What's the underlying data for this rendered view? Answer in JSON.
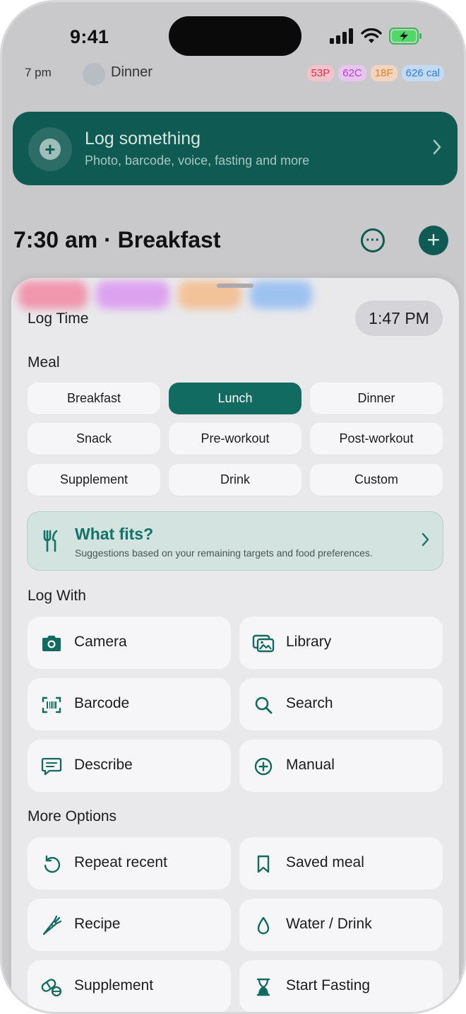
{
  "status_bar": {
    "time": "9:41"
  },
  "background": {
    "dinner_row": {
      "time": "7 pm",
      "label": "Dinner",
      "macros": [
        "53P",
        "62C",
        "18F",
        "626 cal"
      ]
    },
    "log_banner": {
      "title": "Log something",
      "subtitle": "Photo, barcode, voice, fasting and more"
    },
    "meal_title": "7:30 am · Breakfast"
  },
  "sheet": {
    "log_time_label": "Log Time",
    "log_time_value": "1:47 PM",
    "meal_label": "Meal",
    "meals": [
      "Breakfast",
      "Lunch",
      "Dinner",
      "Snack",
      "Pre-workout",
      "Post-workout",
      "Supplement",
      "Drink",
      "Custom"
    ],
    "selected_meal": "Lunch",
    "what_fits": {
      "title": "What fits?",
      "subtitle": "Suggestions based on your remaining targets and food preferences."
    },
    "log_with_label": "Log With",
    "log_with": [
      {
        "label": "Camera",
        "icon": "camera-icon"
      },
      {
        "label": "Library",
        "icon": "photo-library-icon"
      },
      {
        "label": "Barcode",
        "icon": "barcode-icon"
      },
      {
        "label": "Search",
        "icon": "search-icon"
      },
      {
        "label": "Describe",
        "icon": "chat-bubble-icon"
      },
      {
        "label": "Manual",
        "icon": "plus-circle-icon"
      }
    ],
    "more_options_label": "More Options",
    "more_options": [
      {
        "label": "Repeat recent",
        "icon": "repeat-icon"
      },
      {
        "label": "Saved meal",
        "icon": "bookmark-icon"
      },
      {
        "label": "Recipe",
        "icon": "carrot-icon"
      },
      {
        "label": "Water / Drink",
        "icon": "water-drop-icon"
      },
      {
        "label": "Supplement",
        "icon": "pill-icon"
      },
      {
        "label": "Start Fasting",
        "icon": "hourglass-icon"
      }
    ]
  },
  "colors": {
    "accent": "#126b61",
    "banner": "#0f5a52",
    "sheet_bg": "#e9e9ec",
    "button_bg": "#f6f6f8",
    "protein": "#e0314a",
    "carbs": "#b43fd0",
    "fat": "#e0822a",
    "calories": "#2a7fe0"
  }
}
